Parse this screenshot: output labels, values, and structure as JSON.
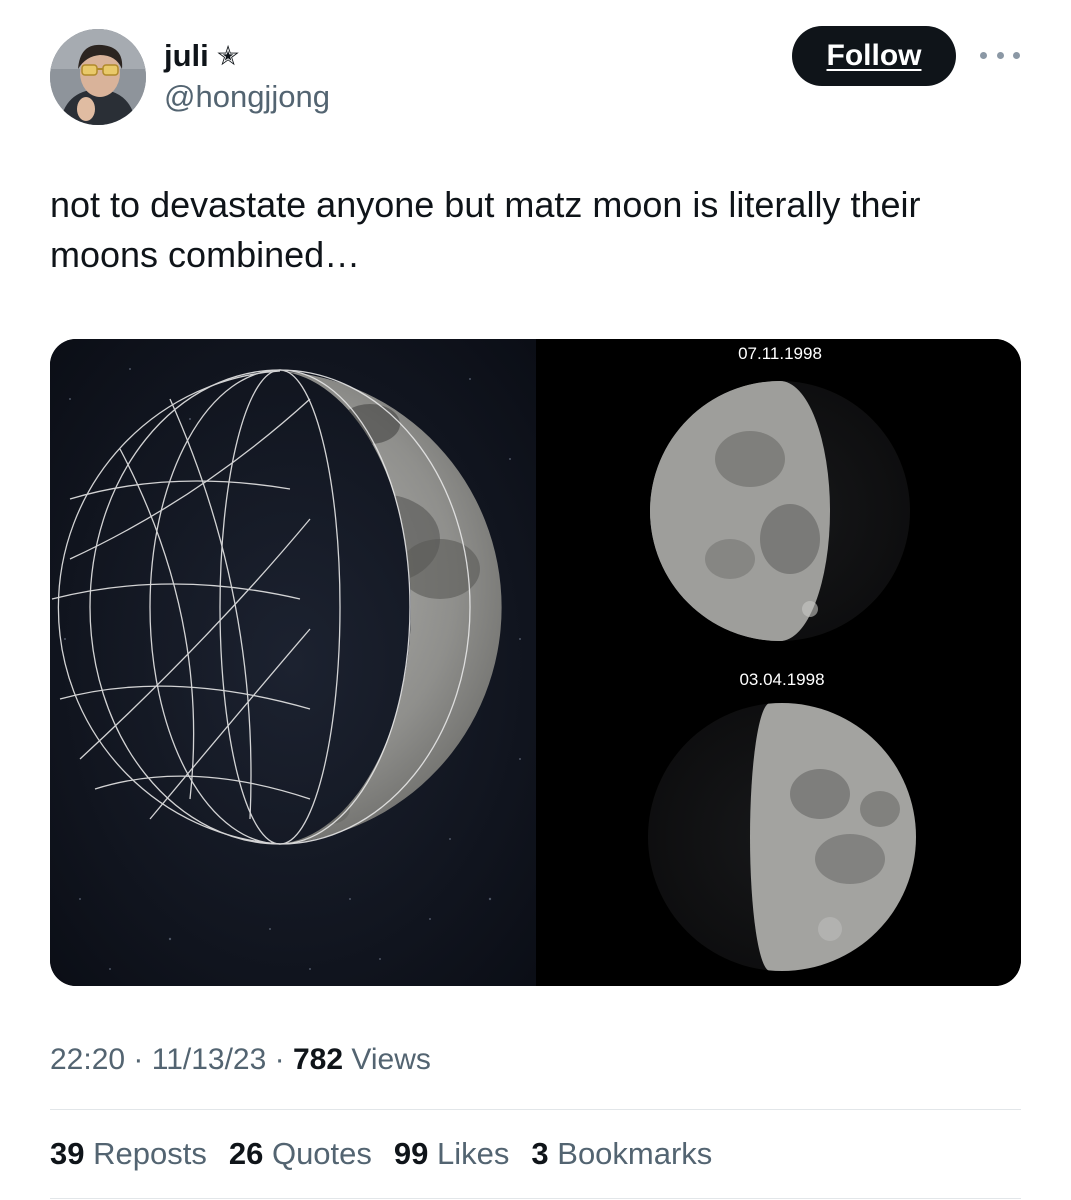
{
  "author": {
    "display_name": "juli",
    "handle": "@hongjjong",
    "name_icon": "star-icon",
    "name_icon_glyph": "✭"
  },
  "follow_label": "Follow",
  "tweet_text": "not to devastate anyone but matz moon is literally their moons combined…",
  "media": {
    "top_date": "07.11.1998",
    "bottom_date": "03.04.1998"
  },
  "meta": {
    "time": "22:20",
    "separator": " · ",
    "date": "11/13/23",
    "views_count": "782",
    "views_label": "Views"
  },
  "stats": [
    {
      "count": "39",
      "label": "Reposts"
    },
    {
      "count": "26",
      "label": "Quotes"
    },
    {
      "count": "99",
      "label": "Likes"
    },
    {
      "count": "3",
      "label": "Bookmarks"
    }
  ],
  "colors": {
    "primary_text": "#0f1419",
    "secondary_text": "#536471",
    "follow_bg": "#0f1419",
    "divider": "#e2e6e9"
  }
}
